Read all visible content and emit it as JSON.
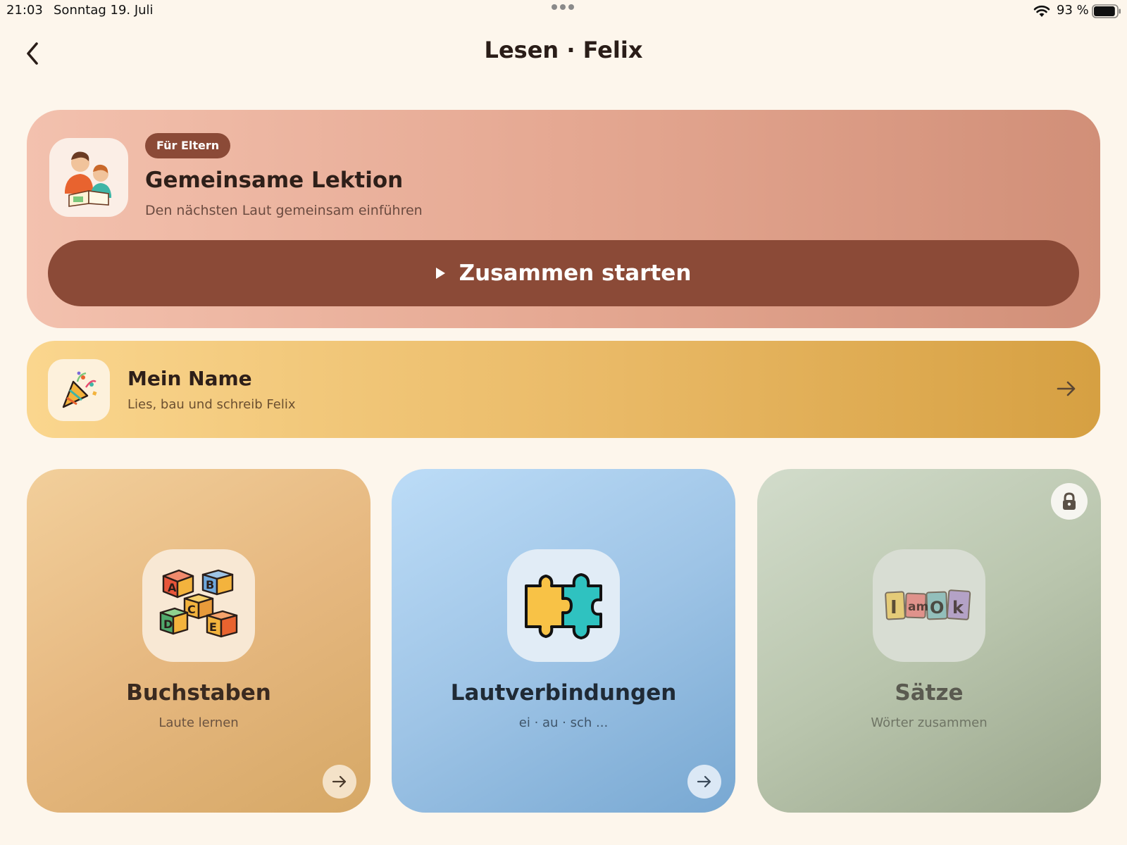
{
  "status_bar": {
    "time": "21:03",
    "date": "Sonntag 19. Juli",
    "battery_percent": "93 %",
    "battery_level": 0.93,
    "wifi_icon": "wifi-icon"
  },
  "header": {
    "title": "Lesen · Felix",
    "back_icon": "chevron-left-icon"
  },
  "hero": {
    "badge": "Für Eltern",
    "title": "Gemeinsame Lektion",
    "subtitle": "Den nächsten Laut gemeinsam einführen",
    "button_label": "Zusammen starten",
    "icon": "parent-child-reading-icon"
  },
  "name_card": {
    "title": "Mein Name",
    "subtitle": "Lies, bau und schreib Felix",
    "icon": "party-popper-icon"
  },
  "tiles": [
    {
      "title": "Buchstaben",
      "subtitle": "Laute lernen",
      "icon": "abc-blocks-icon",
      "locked": false
    },
    {
      "title": "Lautverbindungen",
      "subtitle": "ei · au · sch ...",
      "icon": "puzzle-icon",
      "locked": false
    },
    {
      "title": "Sätze",
      "subtitle": "Wörter zusammen",
      "icon": "word-blocks-icon",
      "locked": true
    }
  ],
  "colors": {
    "background": "#fdf6ec",
    "accent_brown": "#8b4a37",
    "name_card_gold": "#e9b966",
    "tile_tan": "#e6b880",
    "tile_blue": "#9ec4e6",
    "tile_sage": "#bac6ae"
  }
}
